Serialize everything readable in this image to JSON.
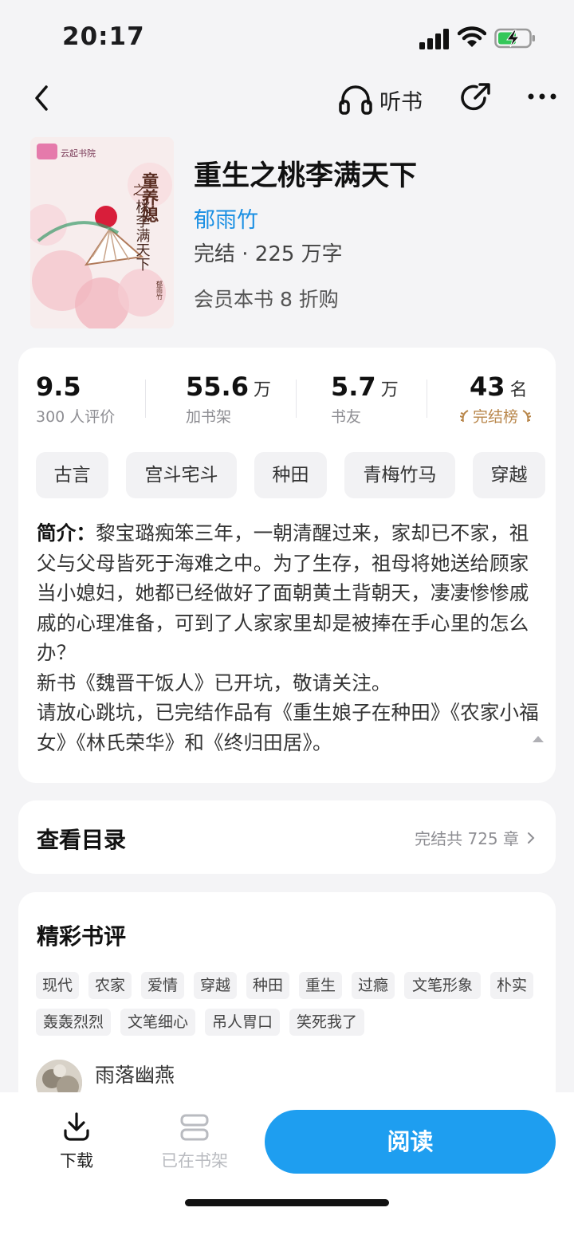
{
  "status": {
    "time": "20:17"
  },
  "nav": {
    "listen_label": "听书"
  },
  "book": {
    "title": "重生之桃李满天下",
    "author": "郁雨竹",
    "meta": "完结 · 225 万字",
    "promo": "会员本书 8 折购",
    "cover_text": "童养媳之桃李满天下",
    "cover_publisher": "云起书院",
    "cover_author": "郁雨竹"
  },
  "stats": [
    {
      "value": "9.5",
      "unit": "",
      "label": "300 人评价"
    },
    {
      "value": "55.6",
      "unit": "万",
      "label": "加书架"
    },
    {
      "value": "5.7",
      "unit": "万",
      "label": "书友"
    },
    {
      "value": "43",
      "unit": "名",
      "label": "完结榜"
    }
  ],
  "tags": [
    "古言",
    "宫斗宅斗",
    "种田",
    "青梅竹马",
    "穿越"
  ],
  "intro": {
    "label": "简介",
    "text": "黎宝璐痴笨三年，一朝清醒过来，家却已不家，祖父与父母皆死于海难之中。为了生存，祖母将她送给顾家当小媳妇，她都已经做好了面朝黄土背朝天，凄凄惨惨戚戚的心理准备，可到了人家家里却是被捧在手心里的怎么办？",
    "line2": "新书《魏晋干饭人》已开坑，敬请关注。",
    "line3": "请放心跳坑，已完结作品有《重生娘子在种田》《农家小福女》《林氏荣华》和《终归田居》。"
  },
  "toc": {
    "title": "查看目录",
    "info": "完结共 725 章"
  },
  "reviews": {
    "title": "精彩书评",
    "tags": [
      "现代",
      "农家",
      "爱情",
      "穿越",
      "种田",
      "重生",
      "过瘾",
      "文笔形象",
      "朴实",
      "轰轰烈烈",
      "文笔细心",
      "吊人胃口",
      "笑死我了"
    ],
    "first_reviewer": "雨落幽燕"
  },
  "bottom": {
    "download_label": "下载",
    "shelf_label": "已在书架",
    "read_label": "阅读"
  },
  "colors": {
    "accent": "#1e9ef0",
    "author": "#1a8fe3",
    "rank": "#b8864a"
  }
}
